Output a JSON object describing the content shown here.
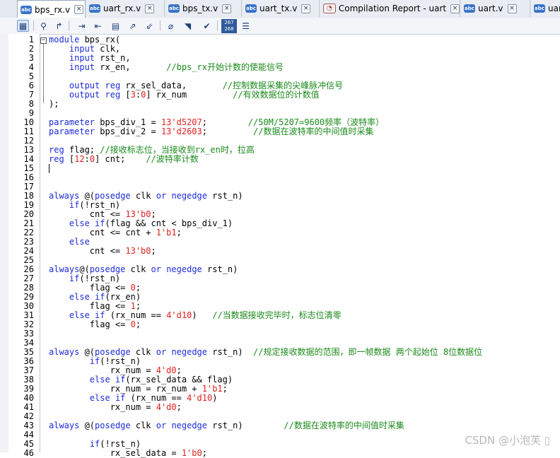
{
  "tabs": [
    {
      "label": "bps_rx.v",
      "icon": "abc-file-icon",
      "active": true
    },
    {
      "label": "uart_rx.v",
      "icon": "abc-file-icon",
      "active": false
    },
    {
      "label": "bps_tx.v",
      "icon": "abc-file-icon",
      "active": false
    },
    {
      "label": "uart_tx.v",
      "icon": "abc-file-icon",
      "active": false
    },
    {
      "label": "Compilation Report - uart",
      "icon": "report-icon",
      "active": false
    },
    {
      "label": "uart.v",
      "icon": "abc-file-icon",
      "active": false
    },
    {
      "label": "uar",
      "icon": "abc-file-icon",
      "active": false
    }
  ],
  "tab_icon_text": "abc",
  "toolbar": {
    "line_counter_top": "267",
    "line_counter_bottom": "268"
  },
  "editor": {
    "lines": [
      {
        "n": "1",
        "t": "module bps_rx("
      },
      {
        "n": "2",
        "t": "    input clk,"
      },
      {
        "n": "3",
        "t": "    input rst_n,"
      },
      {
        "n": "4",
        "t": "    input rx_en,       //bps_rx开始计数的使能信号"
      },
      {
        "n": "5",
        "t": ""
      },
      {
        "n": "6",
        "t": "    output reg rx_sel_data,       //控制数据采集的尖峰脉冲信号"
      },
      {
        "n": "7",
        "t": "    output reg [3:0] rx_num         //有效数据位的计数值"
      },
      {
        "n": "8",
        "t": ");"
      },
      {
        "n": "9",
        "t": ""
      },
      {
        "n": "10",
        "t": "parameter bps_div_1 = 13'd5207;        //50M/5207=9600频率（波特率）"
      },
      {
        "n": "11",
        "t": "parameter bps_div_2 = 13'd2603;         //数据在波特率的中间值时采集"
      },
      {
        "n": "12",
        "t": ""
      },
      {
        "n": "13",
        "t": "reg flag; //接收标志位，当接收到rx_en时，拉高"
      },
      {
        "n": "14",
        "t": "reg [12:0] cnt;    //波特率计数"
      },
      {
        "n": "15",
        "t": ""
      },
      {
        "n": "16",
        "t": ""
      },
      {
        "n": "17",
        "t": ""
      },
      {
        "n": "18",
        "t": "always @(posedge clk or negedge rst_n)"
      },
      {
        "n": "19",
        "t": "    if(!rst_n)"
      },
      {
        "n": "20",
        "t": "        cnt <= 13'b0;"
      },
      {
        "n": "21",
        "t": "    else if(flag && cnt < bps_div_1)"
      },
      {
        "n": "22",
        "t": "        cnt <= cnt + 1'b1;"
      },
      {
        "n": "23",
        "t": "    else"
      },
      {
        "n": "24",
        "t": "        cnt <= 13'b0;"
      },
      {
        "n": "25",
        "t": ""
      },
      {
        "n": "26",
        "t": "always@(posedge clk or negedge rst_n)"
      },
      {
        "n": "27",
        "t": "    if(!rst_n)"
      },
      {
        "n": "28",
        "t": "        flag <= 0;"
      },
      {
        "n": "29",
        "t": "    else if(rx_en)"
      },
      {
        "n": "30",
        "t": "        flag <= 1;"
      },
      {
        "n": "31",
        "t": "    else if (rx_num == 4'd10)   //当数据接收完毕时，标志位清零"
      },
      {
        "n": "32",
        "t": "        flag <= 0;"
      },
      {
        "n": "33",
        "t": ""
      },
      {
        "n": "34",
        "t": ""
      },
      {
        "n": "35",
        "t": "always @(posedge clk or negedge rst_n)  //规定接收数据的范围，即一帧数据 两个起始位 8位数据位"
      },
      {
        "n": "36",
        "t": "        if(!rst_n)"
      },
      {
        "n": "37",
        "t": "            rx_num = 4'd0;"
      },
      {
        "n": "38",
        "t": "        else if(rx_sel_data && flag)"
      },
      {
        "n": "39",
        "t": "            rx_num = rx_num + 1'b1;"
      },
      {
        "n": "40",
        "t": "        else if (rx_num == 4'd10)"
      },
      {
        "n": "41",
        "t": "            rx_num = 4'd0;"
      },
      {
        "n": "42",
        "t": ""
      },
      {
        "n": "43",
        "t": "always @(posedge clk or negedge rst_n)        //数据在波特率的中间值时采集"
      },
      {
        "n": "44",
        "t": ""
      },
      {
        "n": "45",
        "t": "        if(!rst_n)"
      },
      {
        "n": "46",
        "t": "            rx_sel_data = 1'b0;"
      }
    ]
  },
  "watermark": "CSDN @小泡芙 ▯"
}
